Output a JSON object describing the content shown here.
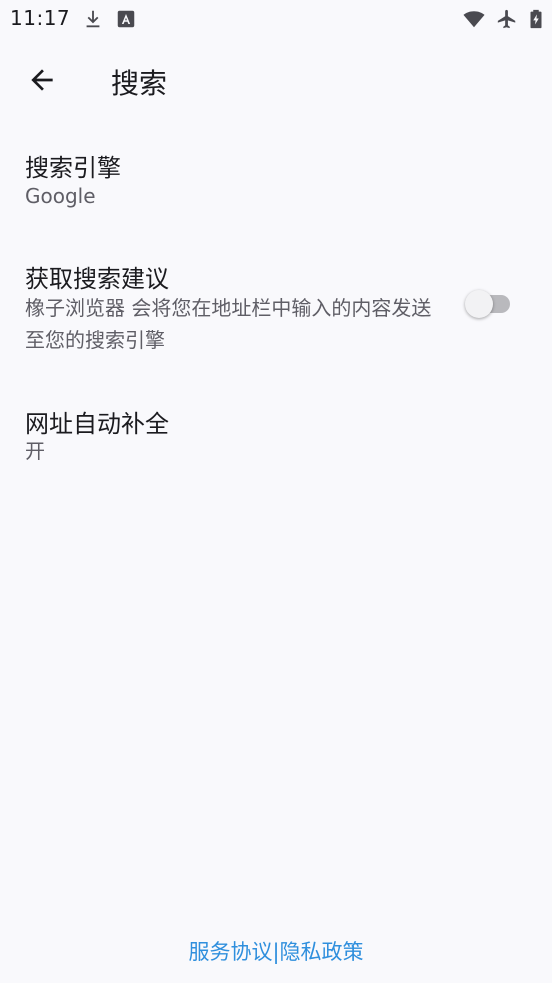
{
  "status_bar": {
    "time": "11:17",
    "icons": [
      "download-icon",
      "app-notification-icon",
      "wifi-icon",
      "airplane-mode-icon",
      "battery-charging-icon"
    ]
  },
  "app_bar": {
    "title": "搜索",
    "back_icon": "arrow-back-icon"
  },
  "preferences": {
    "search_engine": {
      "title": "搜索引擎",
      "summary": "Google"
    },
    "search_suggestions": {
      "title": "获取搜索建议",
      "summary": "橡子浏览器 会将您在地址栏中输入的内容发送至您的搜索引擎",
      "enabled": false
    },
    "url_autocomplete": {
      "title": "网址自动补全",
      "summary": "开"
    }
  },
  "footer": {
    "terms_label": "服务协议",
    "separator": "|",
    "privacy_label": "隐私政策",
    "link_color": "#2f8fdd"
  }
}
